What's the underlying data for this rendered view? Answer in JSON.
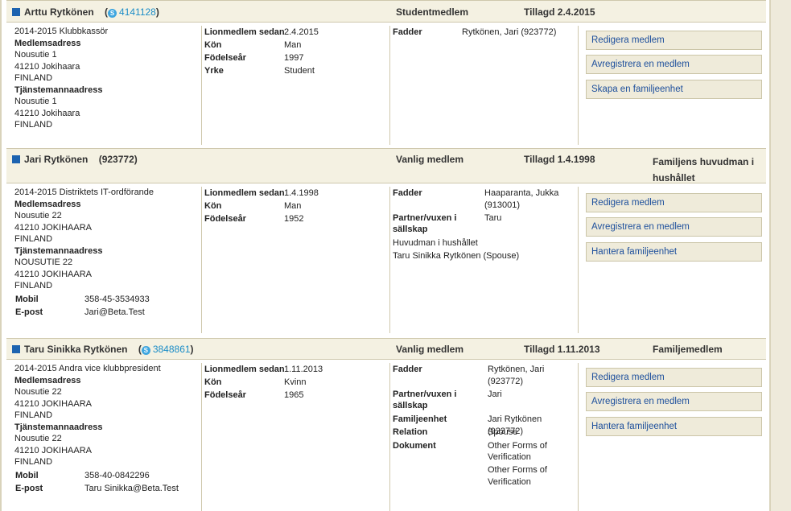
{
  "members": [
    {
      "name": "Arttu  Rytkönen",
      "id": "4141128",
      "type": "Studentmedlem",
      "added": "Tillagd 2.4.2015",
      "role_head": "",
      "position": "2014-2015 Klubbkassör",
      "addr1_label": "Medlemsadress",
      "addr1": [
        "Nousutie 1",
        "41210 Jokihaara",
        "FINLAND"
      ],
      "addr2_label": "Tjänstemannaadress",
      "addr2": [
        "Nousutie 1",
        "41210 Jokihaara",
        "FINLAND"
      ],
      "details": [
        {
          "k": "Lionmedlem sedan",
          "v": "2.4.2015"
        },
        {
          "k": "Kön",
          "v": "Man"
        },
        {
          "k": "Födelseår",
          "v": "1997"
        },
        {
          "k": "Yrke",
          "v": "Student"
        }
      ],
      "sponsor": {
        "k": "Fadder",
        "v": "Rytkönen, Jari    (923772)"
      },
      "buttons": [
        "Redigera medlem",
        "Avregistrera en medlem",
        "Skapa en familjeenhet"
      ]
    },
    {
      "name": "Jari  Rytkönen",
      "id": "(923772)",
      "type": "Vanlig medlem",
      "added": "Tillagd 1.4.1998",
      "role_head": "Familjens huvudman i hushållet",
      "position": "2014-2015 Distriktets IT-ordförande",
      "addr1_label": "Medlemsadress",
      "addr1": [
        "Nousutie 22",
        "41210 JOKIHAARA",
        "FINLAND"
      ],
      "addr2_label": "Tjänstemannaadress",
      "addr2": [
        "NOUSUTIE 22",
        "41210 JOKIHAARA",
        "FINLAND"
      ],
      "contact": [
        {
          "k": "Mobil",
          "v": "358-45-3534933"
        },
        {
          "k": "E-post",
          "v": "Jari@Beta.Test"
        }
      ],
      "details": [
        {
          "k": "Lionmedlem sedan",
          "v": "1.4.1998"
        },
        {
          "k": "Kön",
          "v": "Man"
        },
        {
          "k": "Födelseår",
          "v": "1952"
        }
      ],
      "sponsor": {
        "k": "Fadder",
        "v1": "Haaparanta, Jukka",
        "v2": "(913001)"
      },
      "partner": {
        "k1": "Partner/vuxen i",
        "k2": "sällskap",
        "v": "Taru"
      },
      "household": "Huvudman i hushållet",
      "spouse": "Taru Sinikka Rytkönen (Spouse)",
      "buttons": [
        "Redigera medlem",
        "Avregistrera en medlem",
        "Hantera familjeenhet"
      ]
    },
    {
      "name": "Taru Sinikka  Rytkönen",
      "id": "3848861",
      "type": "Vanlig medlem",
      "added": "Tillagd 1.11.2013",
      "role_head": "Familjemedlem",
      "position": "2014-2015 Andra vice klubbpresident",
      "addr1_label": "Medlemsadress",
      "addr1": [
        "Nousutie 22",
        "41210 JOKIHAARA",
        "FINLAND"
      ],
      "addr2_label": "Tjänstemannaadress",
      "addr2": [
        "Nousutie 22",
        "41210 JOKIHAARA",
        "FINLAND"
      ],
      "contact": [
        {
          "k": "Mobil",
          "v": "358-40-0842296"
        },
        {
          "k": "E-post",
          "v": "Taru Sinikka@Beta.Test"
        }
      ],
      "details": [
        {
          "k": "Lionmedlem sedan",
          "v": "1.11.2013"
        },
        {
          "k": "Kön",
          "v": "Kvinn"
        },
        {
          "k": "Födelseår",
          "v": "1965"
        }
      ],
      "sponsor": {
        "k": "Fadder",
        "v1": "Rytkönen, Jari",
        "v2": "(923772)"
      },
      "partner": {
        "k1": "Partner/vuxen i",
        "k2": "sällskap",
        "v": "Jari"
      },
      "family_unit": {
        "k": "Familjeenhet",
        "v": "Jari Rytkönen (923772)"
      },
      "relation": {
        "k": "Relation",
        "v": "Spouse"
      },
      "documents": {
        "k": "Dokument",
        "v": [
          "Other Forms of",
          "Verification",
          "Other Forms of",
          "Verification"
        ]
      },
      "buttons": [
        "Redigera medlem",
        "Avregistrera en medlem",
        "Hantera familjeenhet"
      ]
    }
  ],
  "colors": {
    "accent": "#1d63b0",
    "link": "#1a8cc7",
    "header_bg": "#f4f1e2",
    "button_bg": "#efebda"
  },
  "icons": {
    "member_marker": "blue-square-icon",
    "id_icon": "skype-icon"
  }
}
